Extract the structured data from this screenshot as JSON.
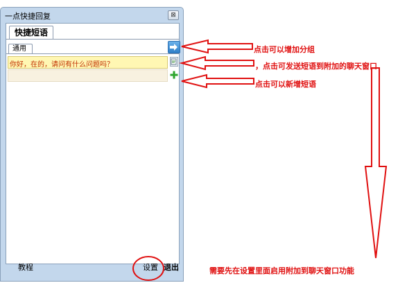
{
  "window": {
    "title": "一点快捷回复",
    "close_glyph": "⊠"
  },
  "tabs": {
    "main_tab_label": "快捷短语",
    "group_tab_label": "通用"
  },
  "phrases": {
    "items": [
      {
        "text": "你好，在的，请问有什么问题吗？"
      }
    ]
  },
  "icons": {
    "add_group": "arrow-right-icon",
    "send_phrase": "send-to-chat-icon",
    "add_phrase": "plus-icon"
  },
  "footer": {
    "tutorial_label": "教程",
    "settings_label": "设置",
    "exit_label": "退出"
  },
  "annotations": {
    "add_group_note": "点击可以增加分组",
    "send_phrase_note": "，点击可发送短语到附加的聊天窗口",
    "add_phrase_note": "点击可以新增短语",
    "setup_note": "需要先在设置里面启用附加到聊天窗口功能"
  },
  "colors": {
    "annotation_red": "#e01010",
    "phrase_highlight": "#fff7b3",
    "phrase_text": "#c03000",
    "window_frame": "#c3d7ec"
  }
}
